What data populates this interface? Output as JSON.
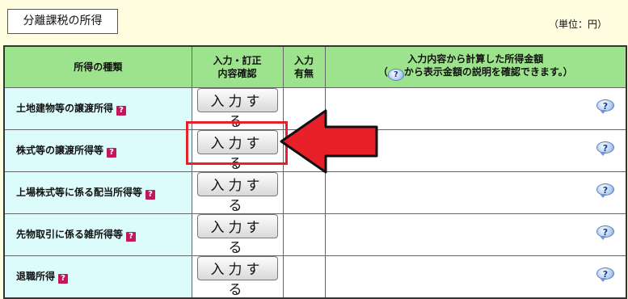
{
  "section_title": "分離課税の所得",
  "unit_label": "（単位：円）",
  "table": {
    "headers": {
      "kind": "所得の種類",
      "entry_line1": "入力・訂正",
      "entry_line2": "内容確認",
      "status_line1": "入力",
      "status_line2": "有無",
      "amount_line1": "入力内容から計算した所得金額",
      "amount_line2_pre": "（",
      "amount_line2_icon": "?",
      "amount_line2_post": "から表示金額の説明を確認できます。）"
    },
    "rows": [
      {
        "label": "土地建物等の譲渡所得",
        "help": "?",
        "button": "入力する",
        "status": "",
        "amount": "",
        "info_icon": "?"
      },
      {
        "label": "株式等の譲渡所得等",
        "help": "?",
        "button": "入力する",
        "status": "",
        "amount": "",
        "info_icon": "?"
      },
      {
        "label": "上場株式等に係る配当所得等",
        "help": "?",
        "button": "入力する",
        "status": "",
        "amount": "",
        "info_icon": "?"
      },
      {
        "label": "先物取引に係る雑所得等",
        "help": "?",
        "button": "入力する",
        "status": "",
        "amount": "",
        "info_icon": "?"
      },
      {
        "label": "退職所得",
        "help": "?",
        "button": "入力する",
        "status": "",
        "amount": "",
        "info_icon": "?"
      }
    ]
  },
  "colors": {
    "header_bg": "#9de28c",
    "label_bg": "#dcfbfb",
    "page_bg": "#fffde0",
    "help_badge": "#c2185b",
    "annotation_red": "#e8202a"
  }
}
